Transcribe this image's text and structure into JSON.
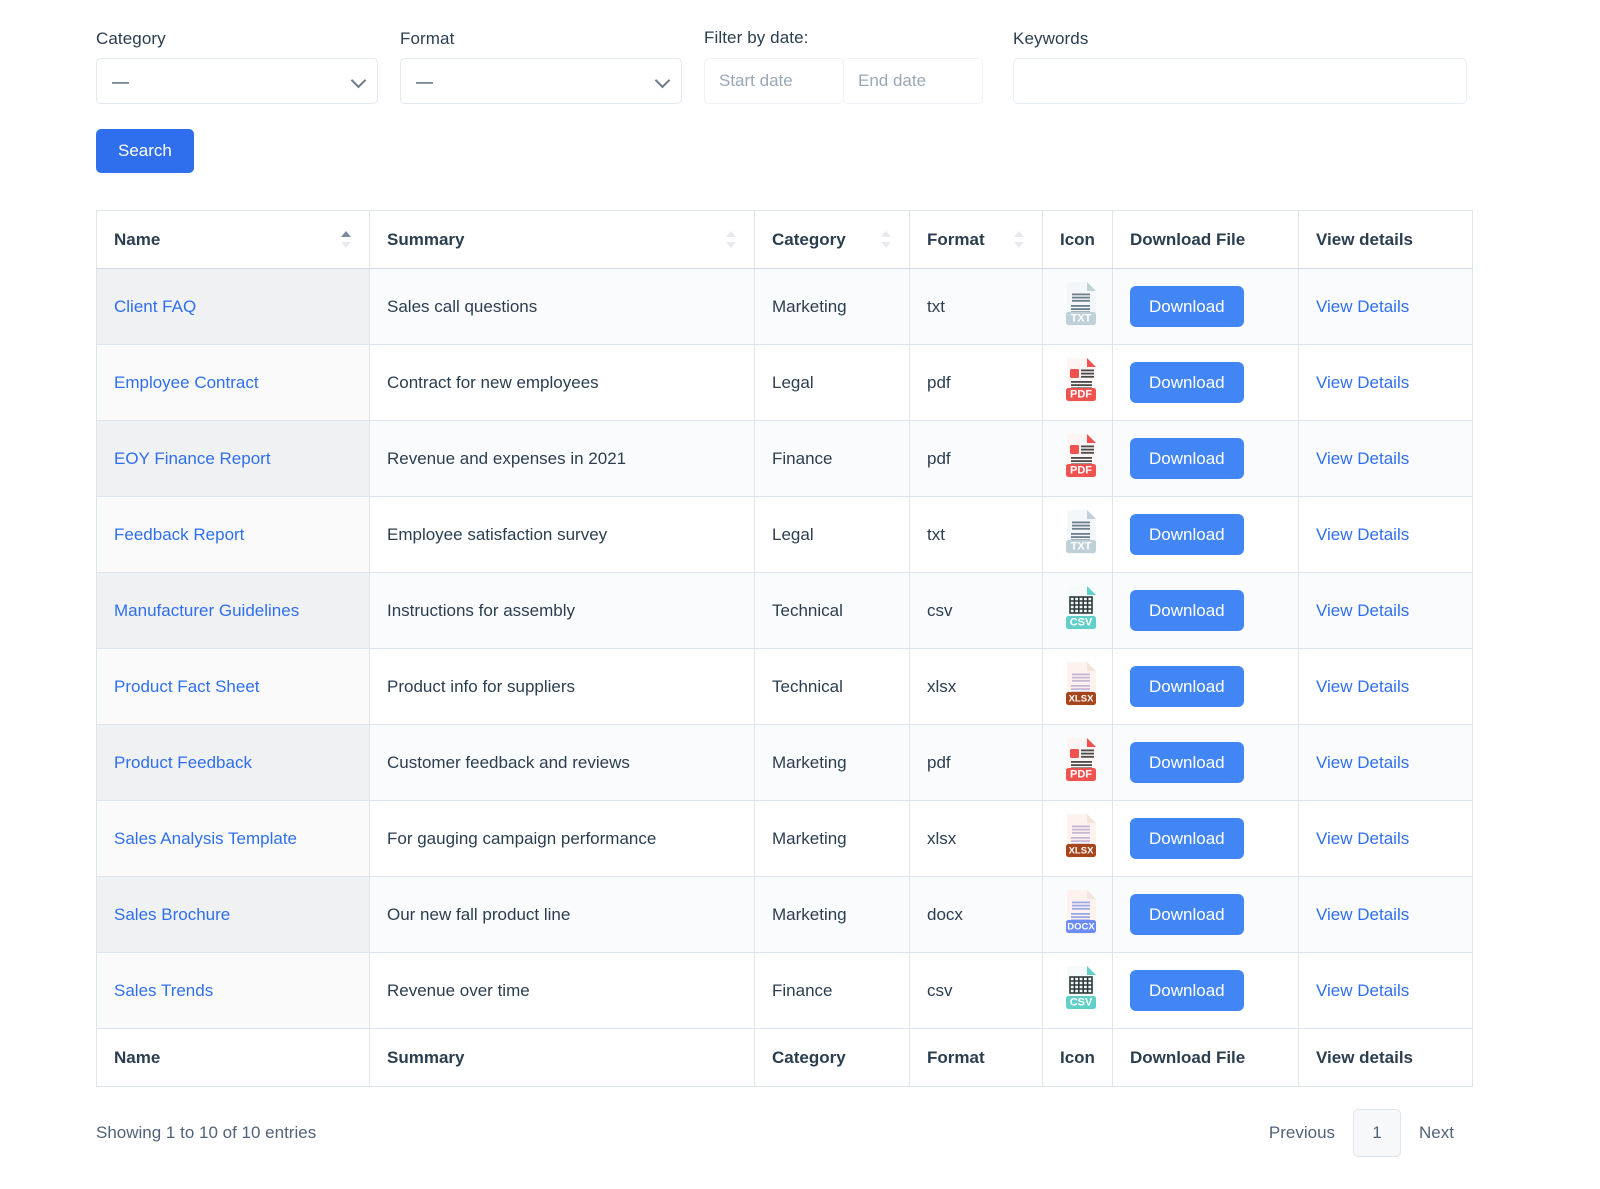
{
  "filters": {
    "category": {
      "label": "Category",
      "value": "—",
      "options": [
        "—"
      ]
    },
    "format": {
      "label": "Format",
      "value": "—",
      "options": [
        "—"
      ]
    },
    "date": {
      "label": "Filter by date:",
      "start_placeholder": "Start date",
      "end_placeholder": "End date",
      "start_value": "",
      "end_value": ""
    },
    "keywords": {
      "label": "Keywords",
      "placeholder": "",
      "value": ""
    },
    "search_button": "Search"
  },
  "table": {
    "columns": [
      {
        "label": "Name",
        "sortable": true,
        "sort": "asc"
      },
      {
        "label": "Summary",
        "sortable": true,
        "sort": "none"
      },
      {
        "label": "Category",
        "sortable": true,
        "sort": "none"
      },
      {
        "label": "Format",
        "sortable": true,
        "sort": "none"
      },
      {
        "label": "Icon",
        "sortable": false,
        "sort": "none"
      },
      {
        "label": "Download File",
        "sortable": false,
        "sort": "none"
      },
      {
        "label": "View details",
        "sortable": false,
        "sort": "none"
      }
    ],
    "footer_columns": [
      "Name",
      "Summary",
      "Category",
      "Format",
      "Icon",
      "Download File",
      "View details"
    ],
    "download_label": "Download",
    "view_label": "View Details",
    "rows": [
      {
        "name": "Client FAQ",
        "summary": "Sales call questions",
        "category": "Marketing",
        "format": "txt",
        "icon": "txt-file-icon"
      },
      {
        "name": "Employee Contract",
        "summary": "Contract for new employees",
        "category": "Legal",
        "format": "pdf",
        "icon": "pdf-file-icon"
      },
      {
        "name": "EOY Finance Report",
        "summary": "Revenue and expenses in 2021",
        "category": "Finance",
        "format": "pdf",
        "icon": "pdf-file-icon"
      },
      {
        "name": "Feedback Report",
        "summary": "Employee satisfaction survey",
        "category": "Legal",
        "format": "txt",
        "icon": "txt-file-icon"
      },
      {
        "name": "Manufacturer Guidelines",
        "summary": "Instructions for assembly",
        "category": "Technical",
        "format": "csv",
        "icon": "csv-file-icon"
      },
      {
        "name": "Product Fact Sheet",
        "summary": "Product info for suppliers",
        "category": "Technical",
        "format": "xlsx",
        "icon": "xlsx-file-icon"
      },
      {
        "name": "Product Feedback",
        "summary": "Customer feedback and reviews",
        "category": "Marketing",
        "format": "pdf",
        "icon": "pdf-file-icon"
      },
      {
        "name": "Sales Analysis Template",
        "summary": "For gauging campaign performance",
        "category": "Marketing",
        "format": "xlsx",
        "icon": "xlsx-file-icon"
      },
      {
        "name": "Sales Brochure",
        "summary": "Our new fall product line",
        "category": "Marketing",
        "format": "docx",
        "icon": "docx-file-icon"
      },
      {
        "name": "Sales Trends",
        "summary": "Revenue over time",
        "category": "Finance",
        "format": "csv",
        "icon": "csv-file-icon"
      }
    ]
  },
  "pagination": {
    "showing": "Showing 1 to 10 of 10 entries",
    "previous": "Previous",
    "next": "Next",
    "pages": [
      "1"
    ],
    "current_page": "1"
  },
  "colors": {
    "primary_blue": "#2f6fed",
    "button_blue": "#4285f4",
    "link_blue": "#2f6fed",
    "text_dark": "#2b3e50",
    "border": "#dfe5ec",
    "pdf_red": "#ef5350",
    "csv_teal": "#63cfc9",
    "xlsx_brown": "#a8441a",
    "docx_blue": "#6b8cf7",
    "txt_gray": "#b7c4cd"
  }
}
